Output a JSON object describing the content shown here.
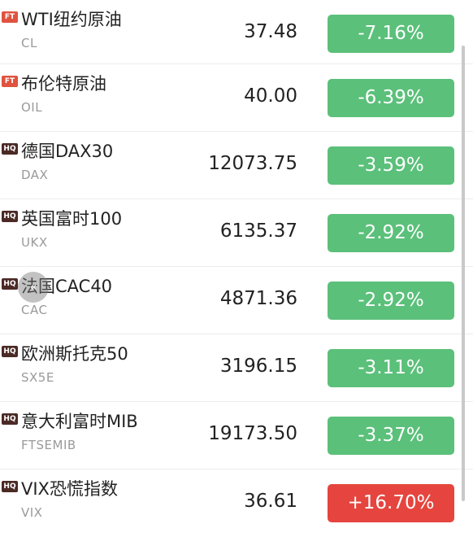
{
  "colors": {
    "down": "#5bc07a",
    "up": "#e5453e",
    "badge_ft": "#e0533f",
    "badge_hq": "#4b2a26"
  },
  "rows": [
    {
      "badge": "FT",
      "name": "WTI纽约原油",
      "code": "CL",
      "price": "37.48",
      "change": "-7.16%",
      "direction": "down"
    },
    {
      "badge": "FT",
      "name": "布伦特原油",
      "code": "OIL",
      "price": "40.00",
      "change": "-6.39%",
      "direction": "down"
    },
    {
      "badge": "HQ",
      "name": "德国DAX30",
      "code": "DAX",
      "price": "12073.75",
      "change": "-3.59%",
      "direction": "down"
    },
    {
      "badge": "HQ",
      "name": "英国富时100",
      "code": "UKX",
      "price": "6135.37",
      "change": "-2.92%",
      "direction": "down"
    },
    {
      "badge": "HQ",
      "name": "法国CAC40",
      "code": "CAC",
      "price": "4871.36",
      "change": "-2.92%",
      "direction": "down"
    },
    {
      "badge": "HQ",
      "name": "欧洲斯托克50",
      "code": "SX5E",
      "price": "3196.15",
      "change": "-3.11%",
      "direction": "down"
    },
    {
      "badge": "HQ",
      "name": "意大利富时MIB",
      "code": "FTSEMIB",
      "price": "19173.50",
      "change": "-3.37%",
      "direction": "down"
    },
    {
      "badge": "HQ",
      "name": "VIX恐慌指数",
      "code": "VIX",
      "price": "36.61",
      "change": "+16.70%",
      "direction": "up"
    }
  ],
  "float_button": {
    "icon": "collapse-arrows-icon",
    "glyph": "«"
  }
}
